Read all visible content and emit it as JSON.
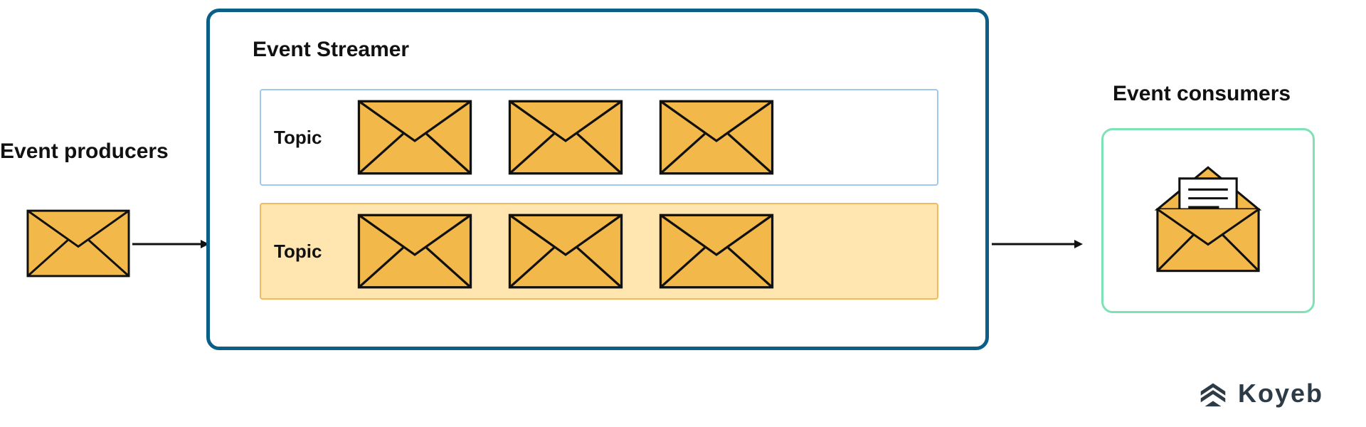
{
  "producers": {
    "label": "Event producers"
  },
  "streamer": {
    "title": "Event Streamer",
    "topics": [
      {
        "label": "Topic",
        "envelope_count": 3
      },
      {
        "label": "Topic",
        "envelope_count": 3
      }
    ]
  },
  "consumers": {
    "label": "Event consumers"
  },
  "brand": {
    "name": "Koyeb"
  },
  "colors": {
    "streamer_border": "#0b5e86",
    "topic1_border": "#9fc8ef",
    "topic2_border": "#eebc5a",
    "topic2_fill": "#ffe5b0",
    "consumer_border": "#7fe2b6",
    "envelope_fill": "#f2b94a",
    "envelope_stroke": "#111111",
    "brand_color": "#2d3b46"
  }
}
